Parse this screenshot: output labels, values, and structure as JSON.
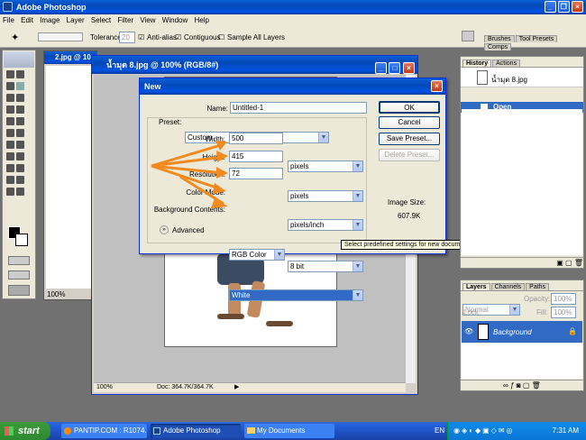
{
  "app": {
    "title": "Adobe Photoshop"
  },
  "menu": [
    "File",
    "Edit",
    "Image",
    "Layer",
    "Select",
    "Filter",
    "View",
    "Window",
    "Help"
  ],
  "options": {
    "tolerance_label": "Tolerance:",
    "tolerance_value": "20",
    "antialias": "Anti-alias",
    "contiguous": "Contiguous",
    "sample_all": "Sample All Layers"
  },
  "palette_well": {
    "tabs": [
      "Brushes",
      "Tool Presets",
      "Comps"
    ]
  },
  "doc_back": {
    "title": "2.jpg @ 10",
    "zoom": "100%"
  },
  "doc_front": {
    "title": "น้ำมุต 8.jpg @ 100% (RGB/8#)",
    "zoom": "100%",
    "status": "Doc: 364.7K/364.7K"
  },
  "dialog": {
    "title": "New",
    "name_label": "Name:",
    "name_value": "Untitled-1",
    "preset_label": "Preset:",
    "preset_value": "Custom",
    "width_label": "Width:",
    "width_value": "500",
    "width_unit": "pixels",
    "height_label": "Height:",
    "height_value": "415",
    "height_unit": "pixels",
    "resolution_label": "Resolution:",
    "resolution_value": "72",
    "resolution_unit": "pixels/inch",
    "color_mode_label": "Color Mode:",
    "color_mode_value": "RGB Color",
    "bit_value": "8 bit",
    "bg_label": "Background Contents:",
    "bg_value": "White",
    "advanced": "Advanced",
    "ok": "OK",
    "cancel": "Cancel",
    "save_preset": "Save Preset...",
    "delete_preset": "Delete Preset...",
    "image_size_label": "Image Size:",
    "image_size_value": "607.9K"
  },
  "tooltip": "Select predefined settings for new documents",
  "history": {
    "tabs": [
      "History",
      "Actions"
    ],
    "snapshot": "น้ำมุต 8.jpg",
    "items": [
      "Open"
    ]
  },
  "layers": {
    "tabs": [
      "Layers",
      "Channels",
      "Paths"
    ],
    "blend": "Normal",
    "opacity_label": "Opacity:",
    "opacity_value": "100%",
    "lock_label": "Lock:",
    "fill_label": "Fill:",
    "fill_value": "100%",
    "layer_name": "Background"
  },
  "taskbar": {
    "start": "start",
    "items": [
      "PANTIP.COM : R1074...",
      "Adobe Photoshop",
      "My Documents"
    ],
    "lang": "EN",
    "time": "7:31 AM"
  },
  "colors": {
    "xp_blue": "#0a5fd8",
    "selection": "#316ac5",
    "arrow": "#f28a1e"
  }
}
